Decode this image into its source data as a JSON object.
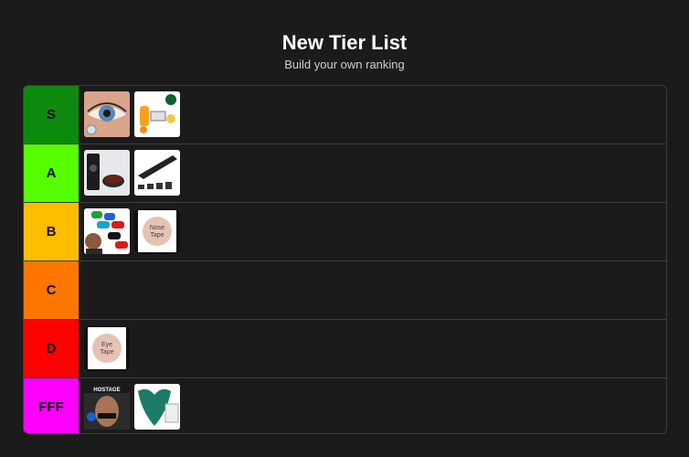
{
  "header": {
    "title": "New Tier List",
    "subtitle": "Build your own ranking"
  },
  "tiers": [
    {
      "label": "S",
      "color": "#0d8a0d",
      "items": [
        "eye-cosmetic-item",
        "fruit-products-item"
      ]
    },
    {
      "label": "A",
      "color": "#55ff00",
      "items": [
        "brow-gel-item",
        "shoe-insoles-item"
      ]
    },
    {
      "label": "B",
      "color": "#ffbd00",
      "items": [
        "mouthguards-item",
        "nose-tape-item"
      ]
    },
    {
      "label": "C",
      "color": "#ff7700",
      "items": []
    },
    {
      "label": "D",
      "color": "#ff0000",
      "items": [
        "eye-tape-item"
      ]
    },
    {
      "label": "FFF",
      "color": "#ff00ff",
      "items": [
        "mouth-tape-item",
        "gua-sha-item"
      ]
    }
  ],
  "item_text": {
    "nose_tape": "Nose Tape",
    "eye_tape": "Eye Tape",
    "hostage": "HOSTAGE"
  }
}
